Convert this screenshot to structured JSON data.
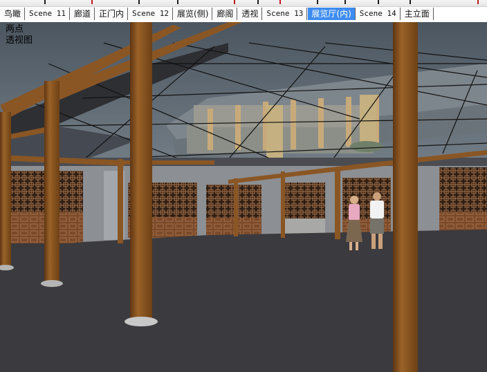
{
  "scene_tabs": [
    {
      "label": "鸟瞰",
      "active": false
    },
    {
      "label": "Scene 11",
      "active": false
    },
    {
      "label": "廊道",
      "active": false
    },
    {
      "label": "正门内",
      "active": false
    },
    {
      "label": "Scene 12",
      "active": false
    },
    {
      "label": "展览(侧)",
      "active": false
    },
    {
      "label": "廊阁",
      "active": false
    },
    {
      "label": "透视",
      "active": false
    },
    {
      "label": "Scene 13",
      "active": false
    },
    {
      "label": "展览厅(内)",
      "active": true
    },
    {
      "label": "Scene 14",
      "active": false
    },
    {
      "label": "主立面",
      "active": false
    }
  ],
  "viewport": {
    "camera_line1": "两点",
    "camera_line2": "透视图"
  },
  "colors": {
    "active_tab": "#3d8cf0",
    "column_wood": "#8a5624",
    "floor": "#3b3a3e",
    "sky": "#5d6770"
  }
}
